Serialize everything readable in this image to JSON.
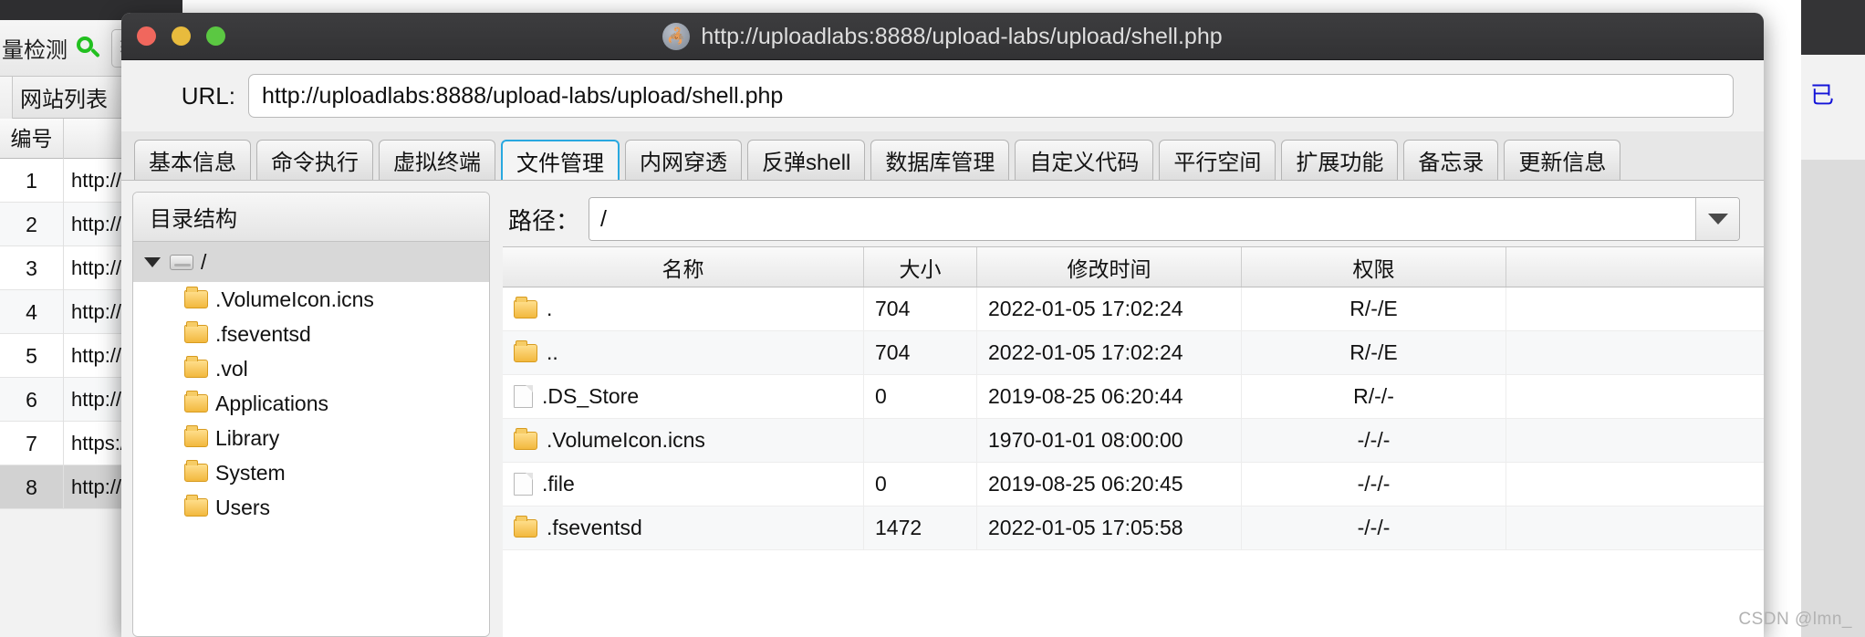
{
  "background_app": {
    "toolbar_title": "量检测",
    "search_icon": "search-icon",
    "toolbar_button_label": "转",
    "list_header": "网站列表",
    "column_header_id": "编号",
    "column_header_url": "",
    "rows": [
      {
        "id": "1",
        "url": "http://"
      },
      {
        "id": "2",
        "url": "http://"
      },
      {
        "id": "3",
        "url": "http://"
      },
      {
        "id": "4",
        "url": "http://"
      },
      {
        "id": "5",
        "url": "http://"
      },
      {
        "id": "6",
        "url": "http://"
      },
      {
        "id": "7",
        "url": "https:/"
      },
      {
        "id": "8",
        "url": "http://"
      }
    ]
  },
  "right_edge": {
    "text": "已"
  },
  "window": {
    "title": "http://uploadlabs:8888/upload-labs/upload/shell.php",
    "app_icon": "scorpion-icon",
    "traffic_lights": {
      "close": "close-button",
      "minimize": "minimize-button",
      "zoom": "zoom-button",
      "close_color": "#f0675d",
      "minimize_color": "#e8bb3d",
      "zoom_color": "#5bc842"
    }
  },
  "url_bar": {
    "label": "URL:",
    "value": "http://uploadlabs:8888/upload-labs/upload/shell.php",
    "placeholder": "http://"
  },
  "tabs": {
    "active_index": 3,
    "active_color": "#29a8e0",
    "items": [
      {
        "label": "基本信息"
      },
      {
        "label": "命令执行"
      },
      {
        "label": "虚拟终端"
      },
      {
        "label": "文件管理"
      },
      {
        "label": "内网穿透"
      },
      {
        "label": "反弹shell"
      },
      {
        "label": "数据库管理"
      },
      {
        "label": "自定义代码"
      },
      {
        "label": "平行空间"
      },
      {
        "label": "扩展功能"
      },
      {
        "label": "备忘录"
      },
      {
        "label": "更新信息"
      }
    ]
  },
  "tree": {
    "header": "目录结构",
    "root": {
      "label": "/",
      "icon": "drive-icon",
      "expanded": true,
      "toggle_icon": "triangle-down-icon"
    },
    "children": [
      {
        "label": ".VolumeIcon.icns",
        "icon": "folder-icon"
      },
      {
        "label": ".fseventsd",
        "icon": "folder-icon"
      },
      {
        "label": ".vol",
        "icon": "folder-icon"
      },
      {
        "label": "Applications",
        "icon": "folder-icon"
      },
      {
        "label": "Library",
        "icon": "folder-icon"
      },
      {
        "label": "System",
        "icon": "folder-icon"
      },
      {
        "label": "Users",
        "icon": "folder-icon"
      }
    ]
  },
  "path_bar": {
    "label": "路径：",
    "value": "/",
    "dropdown_icon": "chevron-down-icon"
  },
  "file_table": {
    "columns": [
      "名称",
      "大小",
      "修改时间",
      "权限",
      ""
    ],
    "rows": [
      {
        "icon": "folder-icon",
        "name": ".",
        "size": "704",
        "mtime": "2022-01-05 17:02:24",
        "perm": "R/-/E"
      },
      {
        "icon": "folder-icon",
        "name": "..",
        "size": "704",
        "mtime": "2022-01-05 17:02:24",
        "perm": "R/-/E"
      },
      {
        "icon": "file-icon",
        "name": ".DS_Store",
        "size": "0",
        "mtime": "2019-08-25 06:20:44",
        "perm": "R/-/-"
      },
      {
        "icon": "folder-icon",
        "name": ".VolumeIcon.icns",
        "size": "",
        "mtime": "1970-01-01 08:00:00",
        "perm": "-/-/-"
      },
      {
        "icon": "file-icon",
        "name": ".file",
        "size": "0",
        "mtime": "2019-08-25 06:20:45",
        "perm": "-/-/-"
      },
      {
        "icon": "folder-icon",
        "name": ".fseventsd",
        "size": "1472",
        "mtime": "2022-01-05 17:05:58",
        "perm": "-/-/-"
      }
    ]
  },
  "watermark": {
    "text": "CSDN @lmn_"
  }
}
